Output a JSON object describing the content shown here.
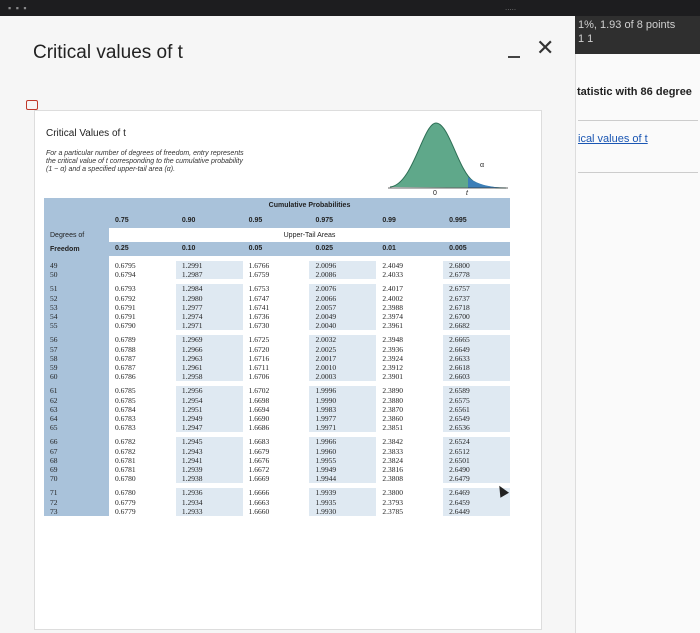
{
  "topbar": {
    "indicator": "....."
  },
  "side": {
    "header_line1": "1%, 1.93 of 8 points",
    "header_line2": "1 1",
    "topic": "tatistic with 86 degree",
    "link": "ical values of t"
  },
  "modal": {
    "title": "Critical values of t"
  },
  "card": {
    "title": "Critical Values of t",
    "desc_lines": [
      "For a particular number of degrees of freedom, entry represents",
      "the critical value of t corresponding to the cumulative probability",
      "(1 − α) and a specified upper-tail area (α)."
    ],
    "curve_labels": {
      "zero": "0",
      "t": "t",
      "alpha": "α"
    }
  },
  "table": {
    "cumulative_header": "Cumulative Probabilities",
    "cumulative": [
      "0.75",
      "0.90",
      "0.95",
      "0.975",
      "0.99",
      "0.995"
    ],
    "upper_header": "Upper-Tail Areas",
    "df_header": [
      "Degrees of",
      "Freedom"
    ],
    "upper": [
      "0.25",
      "0.10",
      "0.05",
      "0.025",
      "0.01",
      "0.005"
    ],
    "blocks": [
      {
        "df": [
          "49",
          "50"
        ],
        "c0": [
          "0.6795",
          "0.6794"
        ],
        "c1": [
          "1.2991",
          "1.2987"
        ],
        "c2": [
          "1.6766",
          "1.6759"
        ],
        "c3": [
          "2.0096",
          "2.0086"
        ],
        "c4": [
          "2.4049",
          "2.4033"
        ],
        "c5": [
          "2.6800",
          "2.6778"
        ]
      },
      {
        "df": [
          "51",
          "52",
          "53",
          "54",
          "55"
        ],
        "c0": [
          "0.6793",
          "0.6792",
          "0.6791",
          "0.6791",
          "0.6790"
        ],
        "c1": [
          "1.2984",
          "1.2980",
          "1.2977",
          "1.2974",
          "1.2971"
        ],
        "c2": [
          "1.6753",
          "1.6747",
          "1.6741",
          "1.6736",
          "1.6730"
        ],
        "c3": [
          "2.0076",
          "2.0066",
          "2.0057",
          "2.0049",
          "2.0040"
        ],
        "c4": [
          "2.4017",
          "2.4002",
          "2.3988",
          "2.3974",
          "2.3961"
        ],
        "c5": [
          "2.6757",
          "2.6737",
          "2.6718",
          "2.6700",
          "2.6682"
        ]
      },
      {
        "df": [
          "56",
          "57",
          "58",
          "59",
          "60"
        ],
        "c0": [
          "0.6789",
          "0.6788",
          "0.6787",
          "0.6787",
          "0.6786"
        ],
        "c1": [
          "1.2969",
          "1.2966",
          "1.2963",
          "1.2961",
          "1.2958"
        ],
        "c2": [
          "1.6725",
          "1.6720",
          "1.6716",
          "1.6711",
          "1.6706"
        ],
        "c3": [
          "2.0032",
          "2.0025",
          "2.0017",
          "2.0010",
          "2.0003"
        ],
        "c4": [
          "2.3948",
          "2.3936",
          "2.3924",
          "2.3912",
          "2.3901"
        ],
        "c5": [
          "2.6665",
          "2.6649",
          "2.6633",
          "2.6618",
          "2.6603"
        ]
      },
      {
        "df": [
          "61",
          "62",
          "63",
          "64",
          "65"
        ],
        "c0": [
          "0.6785",
          "0.6785",
          "0.6784",
          "0.6783",
          "0.6783"
        ],
        "c1": [
          "1.2956",
          "1.2954",
          "1.2951",
          "1.2949",
          "1.2947"
        ],
        "c2": [
          "1.6702",
          "1.6698",
          "1.6694",
          "1.6690",
          "1.6686"
        ],
        "c3": [
          "1.9996",
          "1.9990",
          "1.9983",
          "1.9977",
          "1.9971"
        ],
        "c4": [
          "2.3890",
          "2.3880",
          "2.3870",
          "2.3860",
          "2.3851"
        ],
        "c5": [
          "2.6589",
          "2.6575",
          "2.6561",
          "2.6549",
          "2.6536"
        ]
      },
      {
        "df": [
          "66",
          "67",
          "68",
          "69",
          "70"
        ],
        "c0": [
          "0.6782",
          "0.6782",
          "0.6781",
          "0.6781",
          "0.6780"
        ],
        "c1": [
          "1.2945",
          "1.2943",
          "1.2941",
          "1.2939",
          "1.2938"
        ],
        "c2": [
          "1.6683",
          "1.6679",
          "1.6676",
          "1.6672",
          "1.6669"
        ],
        "c3": [
          "1.9966",
          "1.9960",
          "1.9955",
          "1.9949",
          "1.9944"
        ],
        "c4": [
          "2.3842",
          "2.3833",
          "2.3824",
          "2.3816",
          "2.3808"
        ],
        "c5": [
          "2.6524",
          "2.6512",
          "2.6501",
          "2.6490",
          "2.6479"
        ]
      },
      {
        "df": [
          "71",
          "72",
          "73"
        ],
        "c0": [
          "0.6780",
          "0.6779",
          "0.6779"
        ],
        "c1": [
          "1.2936",
          "1.2934",
          "1.2933"
        ],
        "c2": [
          "1.6666",
          "1.6663",
          "1.6660"
        ],
        "c3": [
          "1.9939",
          "1.9935",
          "1.9930"
        ],
        "c4": [
          "2.3800",
          "2.3793",
          "2.3785"
        ],
        "c5": [
          "2.6469",
          "2.6459",
          "2.6449"
        ]
      }
    ]
  }
}
